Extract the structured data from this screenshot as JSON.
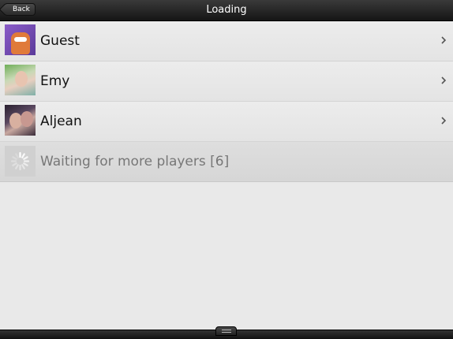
{
  "header": {
    "back_label": "Back",
    "title": "Loading"
  },
  "players": [
    {
      "name": "Guest",
      "avatar_icon": "monster-avatar"
    },
    {
      "name": "Emy",
      "avatar_icon": "photo-avatar"
    },
    {
      "name": "Aljean",
      "avatar_icon": "photo-avatar"
    }
  ],
  "waiting": {
    "label": "Waiting for more players [6]",
    "icon": "spinner-icon"
  },
  "footer": {
    "handle_icon": "drawer-handle-icon"
  },
  "colors": {
    "background": "#e9e9e9",
    "topbar": "#1e1e1e",
    "text": "#111111",
    "waiting_text": "#777777"
  }
}
